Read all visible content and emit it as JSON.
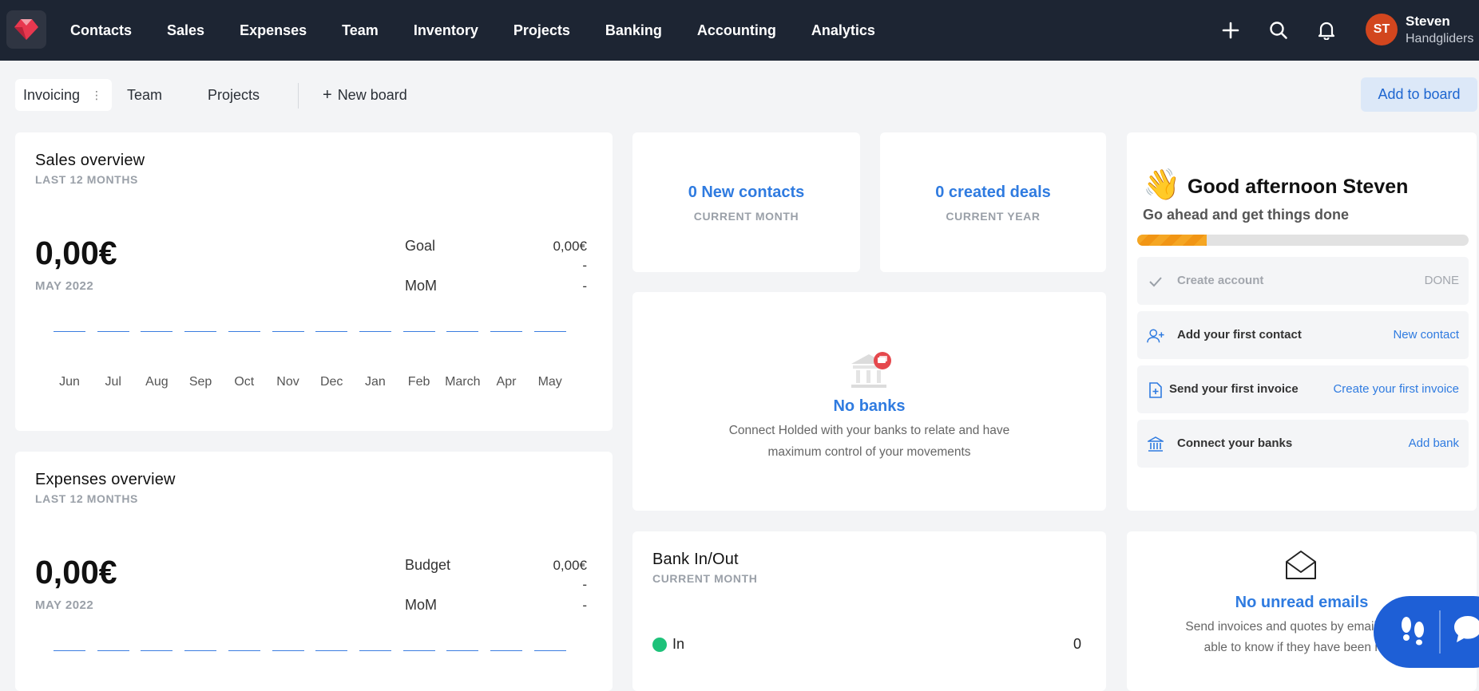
{
  "nav": {
    "items": [
      "Contacts",
      "Sales",
      "Expenses",
      "Team",
      "Inventory",
      "Projects",
      "Banking",
      "Accounting",
      "Analytics"
    ]
  },
  "user": {
    "initials": "ST",
    "name": "Steven",
    "company": "Handgliders"
  },
  "boards": {
    "tabs": [
      "Invoicing",
      "Team",
      "Projects"
    ],
    "new_board": "New board",
    "add_to_board": "Add to board"
  },
  "sales": {
    "title": "Sales overview",
    "sub": "LAST 12 MONTHS",
    "total": "0,00€",
    "period": "MAY 2022",
    "goal_label": "Goal",
    "goal_value": "0,00€",
    "goal_delta": "-",
    "mom_label": "MoM",
    "mom_value": "-",
    "months": [
      "Jun",
      "Jul",
      "Aug",
      "Sep",
      "Oct",
      "Nov",
      "Dec",
      "Jan",
      "Feb",
      "March",
      "Apr",
      "May"
    ]
  },
  "expenses": {
    "title": "Expenses overview",
    "sub": "LAST 12 MONTHS",
    "total": "0,00€",
    "period": "MAY 2022",
    "budget_label": "Budget",
    "budget_value": "0,00€",
    "budget_delta": "-",
    "mom_label": "MoM",
    "mom_value": "-"
  },
  "contacts_stat": {
    "value": "0 New contacts",
    "sub": "CURRENT MONTH"
  },
  "deals_stat": {
    "value": "0 created deals",
    "sub": "CURRENT YEAR"
  },
  "banks": {
    "title": "No banks",
    "desc_line1": "Connect Holded with your banks to relate and have",
    "desc_line2": "maximum control of your movements"
  },
  "bank_inout": {
    "title": "Bank In/Out",
    "sub": "CURRENT MONTH",
    "in_label": "In",
    "in_value": "0",
    "in_color": "#1ec27a"
  },
  "onboarding": {
    "title": "Good afternoon Steven",
    "sub": "Go ahead and get things done",
    "progress": 0.21,
    "steps": [
      {
        "label": "Create account",
        "action": "DONE"
      },
      {
        "label": "Add your first contact",
        "action": "New contact"
      },
      {
        "label": "Send your first invoice",
        "action": "Create your first invoice"
      },
      {
        "label": "Connect your banks",
        "action": "Add bank"
      }
    ]
  },
  "emails": {
    "title": "No unread emails",
    "desc_line1": "Send invoices and quotes by email and be",
    "desc_line2": "able to know if they have been read"
  },
  "colors": {
    "topbar": "#1d2533",
    "accent": "#2f7be0",
    "brand": "#e8384f",
    "avatar": "#d2461e"
  }
}
